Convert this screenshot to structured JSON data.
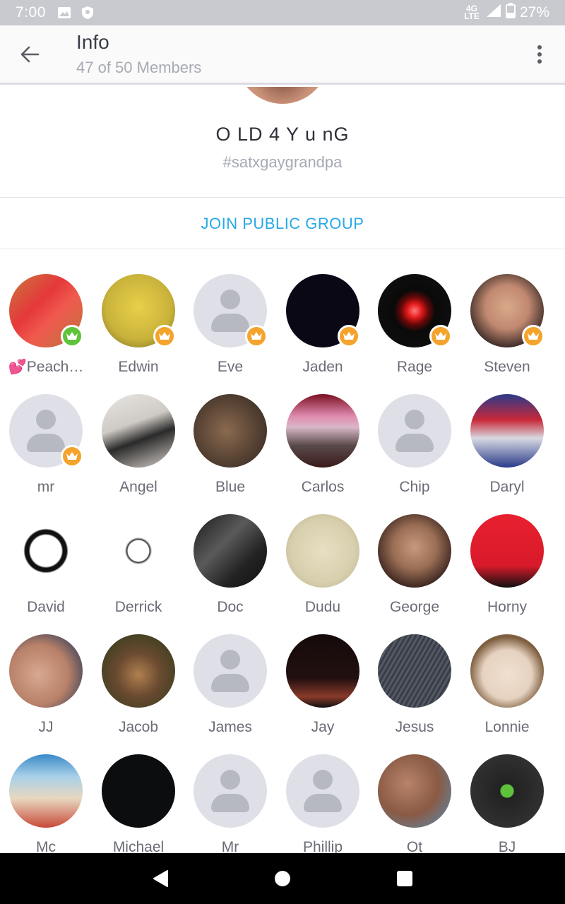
{
  "status_bar": {
    "time": "7:00",
    "network": "4G LTE",
    "battery": "27%"
  },
  "app_bar": {
    "title": "Info",
    "subtitle": "47 of 50 Members"
  },
  "group": {
    "name": "O LD 4 Y u nG",
    "tag": "#satxgaygrandpa",
    "join_label": "JOIN PUBLIC GROUP"
  },
  "colors": {
    "accent": "#27a9e6",
    "badge_orange": "#f4a32c",
    "badge_green": "#5ec33a"
  },
  "members": [
    {
      "name": "💕Peach…",
      "avatar": "photo",
      "bg": "linear-gradient(135deg,#c9783e 0%,#e5383a 40%,#f05a4e 60%,#b8733c 100%)",
      "badge": "green"
    },
    {
      "name": "Edwin",
      "avatar": "photo",
      "bg": "radial-gradient(circle at 50% 45%,#e8d04a 0%,#c9b23a 60%,#6b6220 100%)",
      "badge": "orange"
    },
    {
      "name": "Eve",
      "avatar": "placeholder",
      "bg": "",
      "badge": "orange"
    },
    {
      "name": "Jaden",
      "avatar": "photo",
      "bg": "#0b0816",
      "badge": "orange"
    },
    {
      "name": "Rage",
      "avatar": "photo",
      "bg": "radial-gradient(circle at 50% 50%,#ff7a7a 0%,#e21a1a 14%,#6a0808 26%,#0a0a0a 40%,#111 100%)",
      "badge": "orange"
    },
    {
      "name": "Steven",
      "avatar": "photo",
      "bg": "radial-gradient(circle at 50% 45%,#d9a98a 0%,#c08870 40%,#3a2a26 75%,#eee 100%)",
      "badge": "orange"
    },
    {
      "name": "mr",
      "avatar": "placeholder",
      "bg": "",
      "badge": "orange"
    },
    {
      "name": "Angel",
      "avatar": "photo",
      "bg": "linear-gradient(160deg,#e8e6e3 0%,#cfcac4 40%,#2a2a2a 60%,#d8d2cc 100%)",
      "badge": ""
    },
    {
      "name": "Blue",
      "avatar": "photo",
      "bg": "radial-gradient(circle at 45% 50%,#8a6a50 0%,#5c4636 50%,#2c2420 100%)",
      "badge": ""
    },
    {
      "name": "Carlos",
      "avatar": "photo",
      "bg": "linear-gradient(180deg,#7a1020 0%,#e08ab0 30%,#d9b8c8 45%,#5a4a4a 70%,#3a1a1a 100%)",
      "badge": ""
    },
    {
      "name": "Chip",
      "avatar": "placeholder",
      "bg": "",
      "badge": ""
    },
    {
      "name": "Daryl",
      "avatar": "photo",
      "bg": "linear-gradient(180deg,#2a3a8a 0%,#c82838 35%,#d8dae2 60%,#2a3a8a 100%)",
      "badge": ""
    },
    {
      "name": "David",
      "avatar": "photo",
      "bg": "radial-gradient(circle,#ffffff 0%,#ffffff 30%,#111 33%,#111 40%,#fff 43%)",
      "badge": ""
    },
    {
      "name": "Derrick",
      "avatar": "photo",
      "bg": "radial-gradient(circle,#fff 0%,#fff 20%,#333 22%,#fff 26%,#fff 100%)",
      "badge": ""
    },
    {
      "name": "Doc",
      "avatar": "photo",
      "bg": "linear-gradient(135deg,#1a1a1a 0%,#5a5a5a 40%,#222 70%,#111 100%)",
      "badge": ""
    },
    {
      "name": "Dudu",
      "avatar": "photo",
      "bg": "radial-gradient(circle,#e8dfc4 0%,#d8cfae 60%,#b7ae8a 100%)",
      "badge": ""
    },
    {
      "name": "George",
      "avatar": "photo",
      "bg": "radial-gradient(circle at 50% 45%,#c79a7c 0%,#9a6e54 40%,#3a2420 75%,#1a1a1a 100%)",
      "badge": ""
    },
    {
      "name": "Horny",
      "avatar": "photo",
      "bg": "linear-gradient(180deg,#e82030 0%,#d81a2a 70%,#111 100%)",
      "badge": ""
    },
    {
      "name": "JJ",
      "avatar": "photo",
      "bg": "radial-gradient(circle at 40% 55%,#d8a890 0%,#b88068 50%,#2a3a5a 90%)",
      "badge": ""
    },
    {
      "name": "Jacob",
      "avatar": "photo",
      "bg": "radial-gradient(circle at 50% 55%,#b08050 0%,#6a4a30 40%,#2a3a1a 100%)",
      "badge": ""
    },
    {
      "name": "James",
      "avatar": "placeholder",
      "bg": "",
      "badge": ""
    },
    {
      "name": "Jay",
      "avatar": "photo",
      "bg": "linear-gradient(180deg,#150a0a 0%,#221010 60%,#8a3a2a 85%,#111 100%)",
      "badge": ""
    },
    {
      "name": "Jesus",
      "avatar": "photo",
      "bg": "repeating-linear-gradient(120deg,#3a3e48 0px,#5a606c 3px,#2a2e36 6px)",
      "badge": ""
    },
    {
      "name": "Lonnie",
      "avatar": "photo",
      "bg": "radial-gradient(circle at 50% 55%,#f0e0d0 0%,#e6d2c0 45%,#7a5a3a 70%,#eee 100%)",
      "badge": ""
    },
    {
      "name": "Mc",
      "avatar": "photo",
      "bg": "linear-gradient(180deg,#3a8ac8 0%,#a8d0e8 30%,#e8d8c0 60%,#c84a3a 100%)",
      "badge": ""
    },
    {
      "name": "Michael",
      "avatar": "photo",
      "bg": "#0c0d0f",
      "badge": ""
    },
    {
      "name": "Mr",
      "avatar": "placeholder",
      "bg": "",
      "badge": ""
    },
    {
      "name": "Phillip",
      "avatar": "placeholder",
      "bg": "",
      "badge": ""
    },
    {
      "name": "Ot",
      "avatar": "photo",
      "bg": "radial-gradient(circle at 40% 40%,#b8846a 0%,#8a5a44 50%,#6a7a8a 80%)",
      "badge": ""
    },
    {
      "name": "BJ",
      "avatar": "photo",
      "bg": "radial-gradient(circle,#5ec33a 0%,#5ec33a 12%,#222 14%,#333 80%,#fff 82%,#3aa8d8 90%)",
      "badge": ""
    }
  ]
}
